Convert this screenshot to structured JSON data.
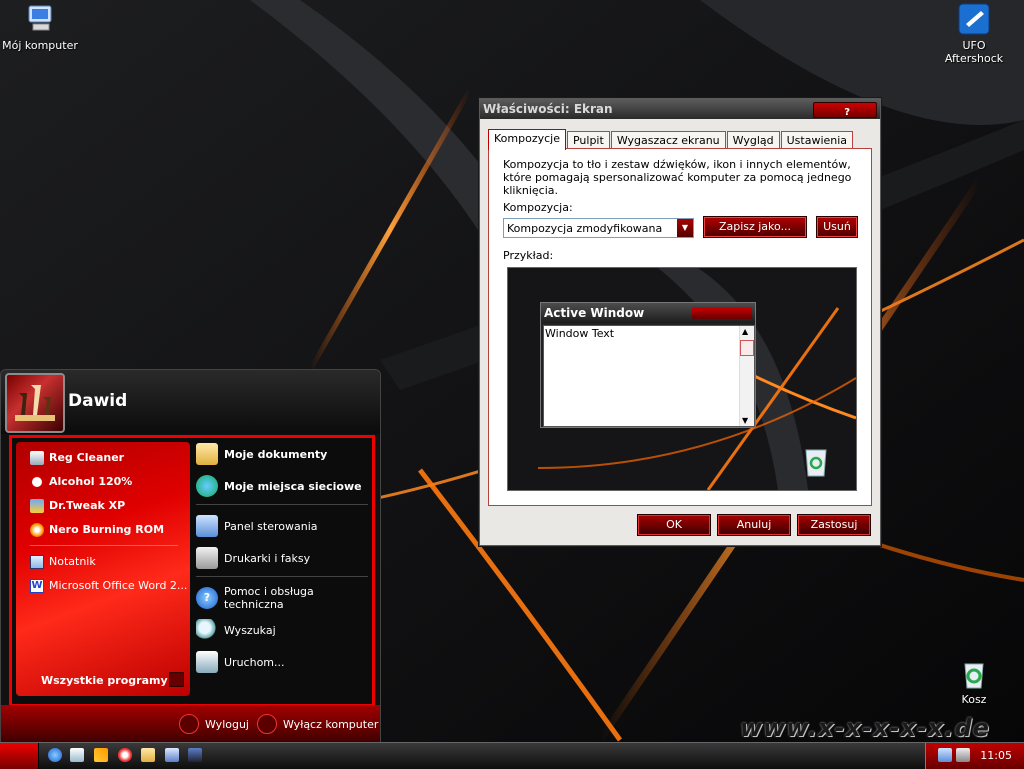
{
  "desktop": {
    "icons": [
      {
        "label": "Mój komputer"
      },
      {
        "label": "UFO Aftershock"
      },
      {
        "label": "Kosz"
      }
    ],
    "watermark": "www.x-x-x-x-x.de"
  },
  "dialog": {
    "title": "Właściwości: Ekran",
    "help_glyph": "?",
    "tabs": [
      "Kompozycje",
      "Pulpit",
      "Wygaszacz ekranu",
      "Wygląd",
      "Ustawienia"
    ],
    "active_tab": "Kompozycje",
    "description": "Kompozycja to tło i zestaw dźwięków, ikon i innych elementów, które pomagają spersonalizować komputer za pomocą jednego kliknięcia.",
    "theme_label": "Kompozycja:",
    "theme_value": "Kompozycja zmodyfikowana",
    "save_as_label": "Zapisz jako...",
    "delete_label": "Usuń",
    "preview_label": "Przykład:",
    "preview": {
      "window_title": "Active Window",
      "window_text": "Window Text"
    },
    "ok_label": "OK",
    "cancel_label": "Anuluj",
    "apply_label": "Zastosuj"
  },
  "start_menu": {
    "user_name": "Dawid",
    "pinned": [
      {
        "label": "Reg Cleaner",
        "icon": "reg-cleaner-icon"
      },
      {
        "label": "Alcohol 120%",
        "icon": "alcohol-icon"
      },
      {
        "label": "Dr.Tweak XP",
        "icon": "dr-tweak-icon"
      },
      {
        "label": "Nero Burning ROM",
        "icon": "nero-icon"
      }
    ],
    "recent": [
      {
        "label": "Notatnik",
        "icon": "notepad-icon"
      },
      {
        "label": "Microsoft Office Word 2...",
        "icon": "word-icon"
      }
    ],
    "all_programs_label": "Wszystkie programy",
    "places": [
      {
        "label": "Moje dokumenty",
        "icon": "my-documents-icon"
      },
      {
        "label": "Moje miejsca sieciowe",
        "icon": "network-places-icon"
      }
    ],
    "settings": [
      {
        "label": "Panel sterowania",
        "icon": "control-panel-icon"
      },
      {
        "label": "Drukarki i faksy",
        "icon": "printers-icon"
      }
    ],
    "tools": [
      {
        "label": "Pomoc i obsługa techniczna",
        "icon": "help-icon"
      },
      {
        "label": "Wyszukaj",
        "icon": "search-icon"
      },
      {
        "label": "Uruchom...",
        "icon": "run-icon"
      }
    ],
    "logoff_label": "Wyloguj",
    "shutdown_label": "Wyłącz komputer"
  },
  "taskbar": {
    "clock": "11:05"
  },
  "colors": {
    "accent_red": "#e00000",
    "dark_red": "#5a0000"
  }
}
